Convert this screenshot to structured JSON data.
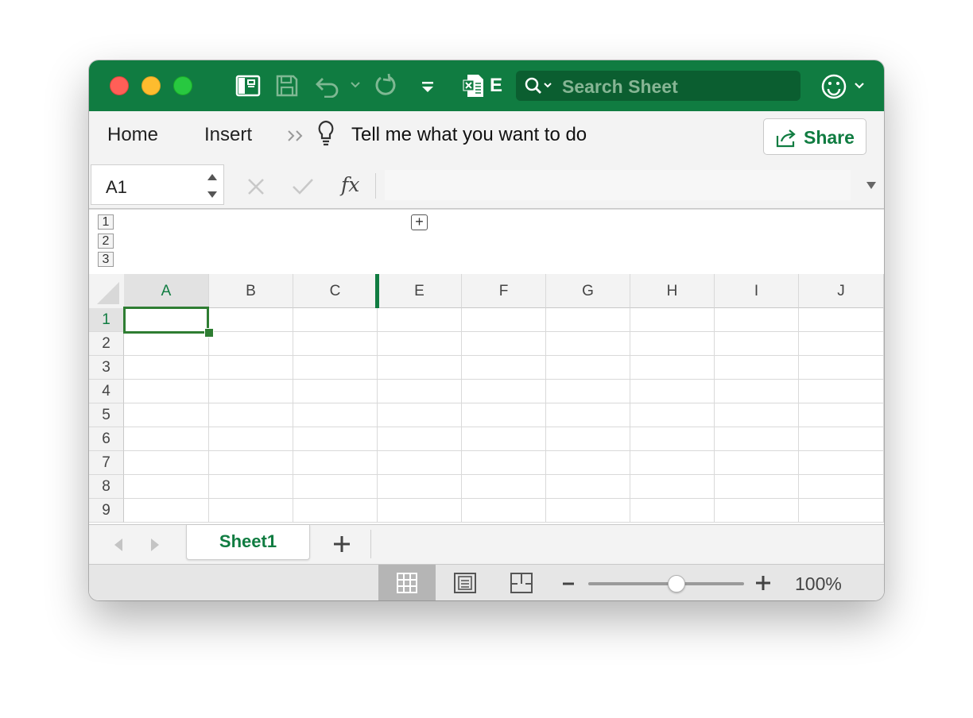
{
  "titlebar": {
    "title_char": "E",
    "search_placeholder": "Search Sheet",
    "icons": [
      "sidebar-toggle-icon",
      "save-icon",
      "undo-icon",
      "redo-icon",
      "customize-toolbar-icon",
      "excel-doc-icon",
      "search-icon",
      "feedback-smiley-icon"
    ]
  },
  "ribbon": {
    "tabs": [
      "Home",
      "Insert"
    ],
    "tell_me": "Tell me what you want to do",
    "share_label": "Share"
  },
  "formula_bar": {
    "name_box": "A1",
    "fx_label": "fx",
    "content": ""
  },
  "outline": {
    "levels": [
      "1",
      "2",
      "3"
    ]
  },
  "grid": {
    "columns": [
      "A",
      "B",
      "C",
      "E",
      "F",
      "G",
      "H",
      "I",
      "J"
    ],
    "rows": [
      "1",
      "2",
      "3",
      "4",
      "5",
      "6",
      "7",
      "8",
      "9"
    ],
    "selected_cell": "A1"
  },
  "sheets": {
    "tabs": [
      "Sheet1"
    ],
    "active": "Sheet1"
  },
  "status": {
    "zoom_label": "100%",
    "zoom_fraction": 0.5,
    "active_view": "normal"
  },
  "colors": {
    "brand": "#107c41",
    "selection": "#2e7d32"
  }
}
